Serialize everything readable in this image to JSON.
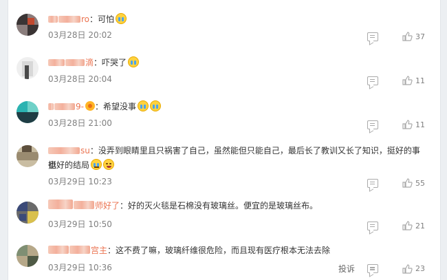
{
  "comments": [
    {
      "name_suffix": "ro",
      "text": "：可怕",
      "emojis": [
        "cry"
      ],
      "time": "03月28日 20:02",
      "likes": "37",
      "avatar_colors": [
        "#3a3434",
        "#8a7d7c",
        "#c1492f"
      ]
    },
    {
      "name_suffix": "滴",
      "text": "：吓哭了",
      "emojis": [
        "cry"
      ],
      "time": "03月28日 20:04",
      "likes": "11",
      "avatar_colors": [
        "#d8d8d8",
        "#4a4a4a",
        "#efefef"
      ]
    },
    {
      "name_suffix": "9-",
      "text": "：希望没事",
      "emojis": [
        "cry",
        "cry"
      ],
      "time": "03月28日 21:00",
      "likes": "11",
      "avatar_colors": [
        "#2bb3b1",
        "#1f3d44",
        "#6fd1c8"
      ]
    },
    {
      "name_suffix": "su",
      "text": "：没弄到眼睛里且只祸害了自己，虽然能但只能自己，最后长了教训又长了知识，挺好的事也",
      "text2": "挺好的结局",
      "emojis": [
        "sweat",
        "laugh"
      ],
      "time": "03月29日 10:23",
      "likes": "55",
      "avatar_colors": [
        "#9a8b70",
        "#5d4f3d",
        "#c9bda2"
      ]
    },
    {
      "name_suffix": "师好了",
      "text": "：好的灭火毯是石棉没有玻璃丝。便宜的是玻璃丝布。",
      "emojis": [],
      "time": "03月29日 10:50",
      "likes": "21",
      "avatar_colors": [
        "#3b4a78",
        "#d9c04d",
        "#6a6a6a"
      ]
    },
    {
      "name_suffix": "宫主",
      "text": "：这不费了嘛，玻璃纤维很危险，而且现有医疗根本无法去除",
      "emojis": [],
      "time": "03月29日 10:36",
      "likes": "23",
      "avatar_colors": [
        "#7f8f73",
        "#b6a889",
        "#4f5a45"
      ],
      "report": "投诉"
    }
  ]
}
